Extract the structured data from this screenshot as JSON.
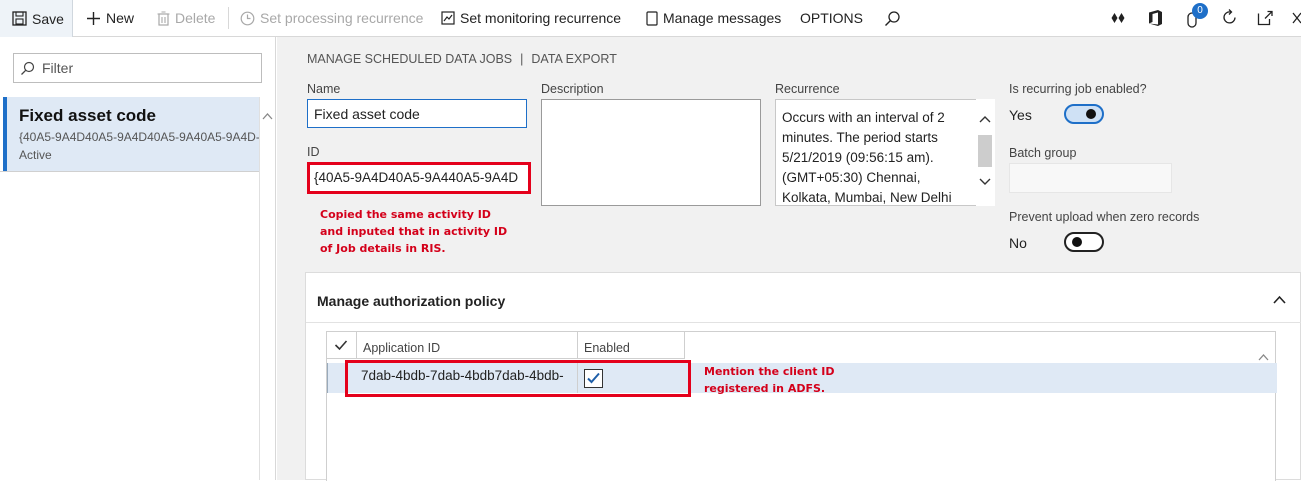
{
  "toolbar": {
    "save_label": "Save",
    "new_label": "New",
    "delete_label": "Delete",
    "set_processing_label": "Set processing recurrence",
    "set_monitoring_label": "Set monitoring recurrence",
    "manage_messages_label": "Manage messages",
    "options_label": "OPTIONS",
    "notification_count": "0"
  },
  "list": {
    "filter_placeholder": "Filter",
    "items": [
      {
        "title": "Fixed asset code",
        "subtitle": "{40A5-9A4D40A5-9A4D40A5-9A40A5-9A4D-",
        "status": "Active"
      }
    ]
  },
  "header": {
    "breadcrumb_left": "MANAGE SCHEDULED DATA JOBS",
    "breadcrumb_divider": "|",
    "breadcrumb_right": "DATA EXPORT"
  },
  "form": {
    "name_label": "Name",
    "name_value": "Fixed asset code",
    "id_label": "ID",
    "id_value": "{40A5-9A4D40A5-9A440A5-9A4D",
    "description_label": "Description",
    "description_value": "",
    "recurrence_label": "Recurrence",
    "recurrence_value": "Occurs with an interval of 2 minutes. The period starts 5/21/2019 (09:56:15 am). (GMT+05:30) Chennai, Kolkata, Mumbai, New Delhi",
    "recurring_label": "Is recurring job enabled?",
    "recurring_value": "Yes",
    "batch_group_label": "Batch group",
    "batch_group_value": "",
    "prevent_upload_label": "Prevent upload when zero records",
    "prevent_upload_value": "No"
  },
  "annotations": {
    "id_note_1": "Copied the same activity ID",
    "id_note_2": "and inputed that in  activity ID",
    "id_note_3": "of Job details in RIS.",
    "client_note_1": "Mention the client ID",
    "client_note_2": "registered in ADFS."
  },
  "auth_policy": {
    "title": "Manage authorization policy",
    "columns": [
      "Application ID",
      "Enabled"
    ],
    "rows": [
      {
        "application_id": "7dab-4bdb-7dab-4bdb7dab-4bdb-",
        "enabled": true
      }
    ]
  },
  "colors": {
    "accent": "#1e6fc8",
    "annotation_red": "#e4001b",
    "selection": "#dfe9f5"
  },
  "icons": [
    "save-icon",
    "plus-icon",
    "trash-icon",
    "clock-icon",
    "chart-icon",
    "page-icon",
    "search-icon",
    "diamond-icon",
    "office-icon",
    "attachment-icon",
    "refresh-icon",
    "popout-icon",
    "close-icon",
    "filter-search-icon",
    "chevron-up-icon",
    "chevron-down-icon",
    "checkmark-icon"
  ]
}
